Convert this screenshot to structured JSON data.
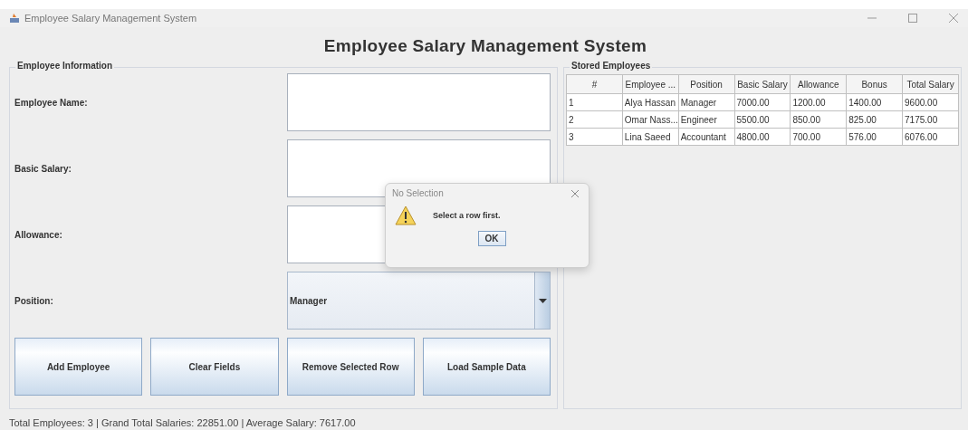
{
  "window": {
    "title": "Employee Salary Management System"
  },
  "heading": "Employee Salary Management System",
  "employee_form": {
    "legend": "Employee Information",
    "fields": [
      {
        "kind": "text",
        "label": "Employee Name:"
      },
      {
        "kind": "text",
        "label": "Basic Salary:"
      },
      {
        "kind": "text",
        "label": "Allowance:"
      },
      {
        "kind": "combo",
        "label": "Position:",
        "value": "Manager"
      }
    ],
    "buttons": [
      "Add Employee",
      "Clear Fields",
      "Remove Selected Row",
      "Load Sample Data"
    ]
  },
  "table": {
    "legend": "Stored Employees",
    "columns": [
      "#",
      "Employee ...",
      "Position",
      "Basic Salary",
      "Allowance",
      "Bonus",
      "Total Salary"
    ],
    "rows": [
      [
        "1",
        "Alya Hassan",
        "Manager",
        "7000.00",
        "1200.00",
        "1400.00",
        "9600.00"
      ],
      [
        "2",
        "Omar Nass...",
        "Engineer",
        "5500.00",
        "850.00",
        "825.00",
        "7175.00"
      ],
      [
        "3",
        "Lina Saeed",
        "Accountant",
        "4800.00",
        "700.00",
        "576.00",
        "6076.00"
      ]
    ]
  },
  "dialog": {
    "title": "No Selection",
    "message": "Select a row first.",
    "button": "OK"
  },
  "status_bar": "Total Employees: 3 | Grand Total Salaries: 22851.00 | Average Salary: 7617.00"
}
